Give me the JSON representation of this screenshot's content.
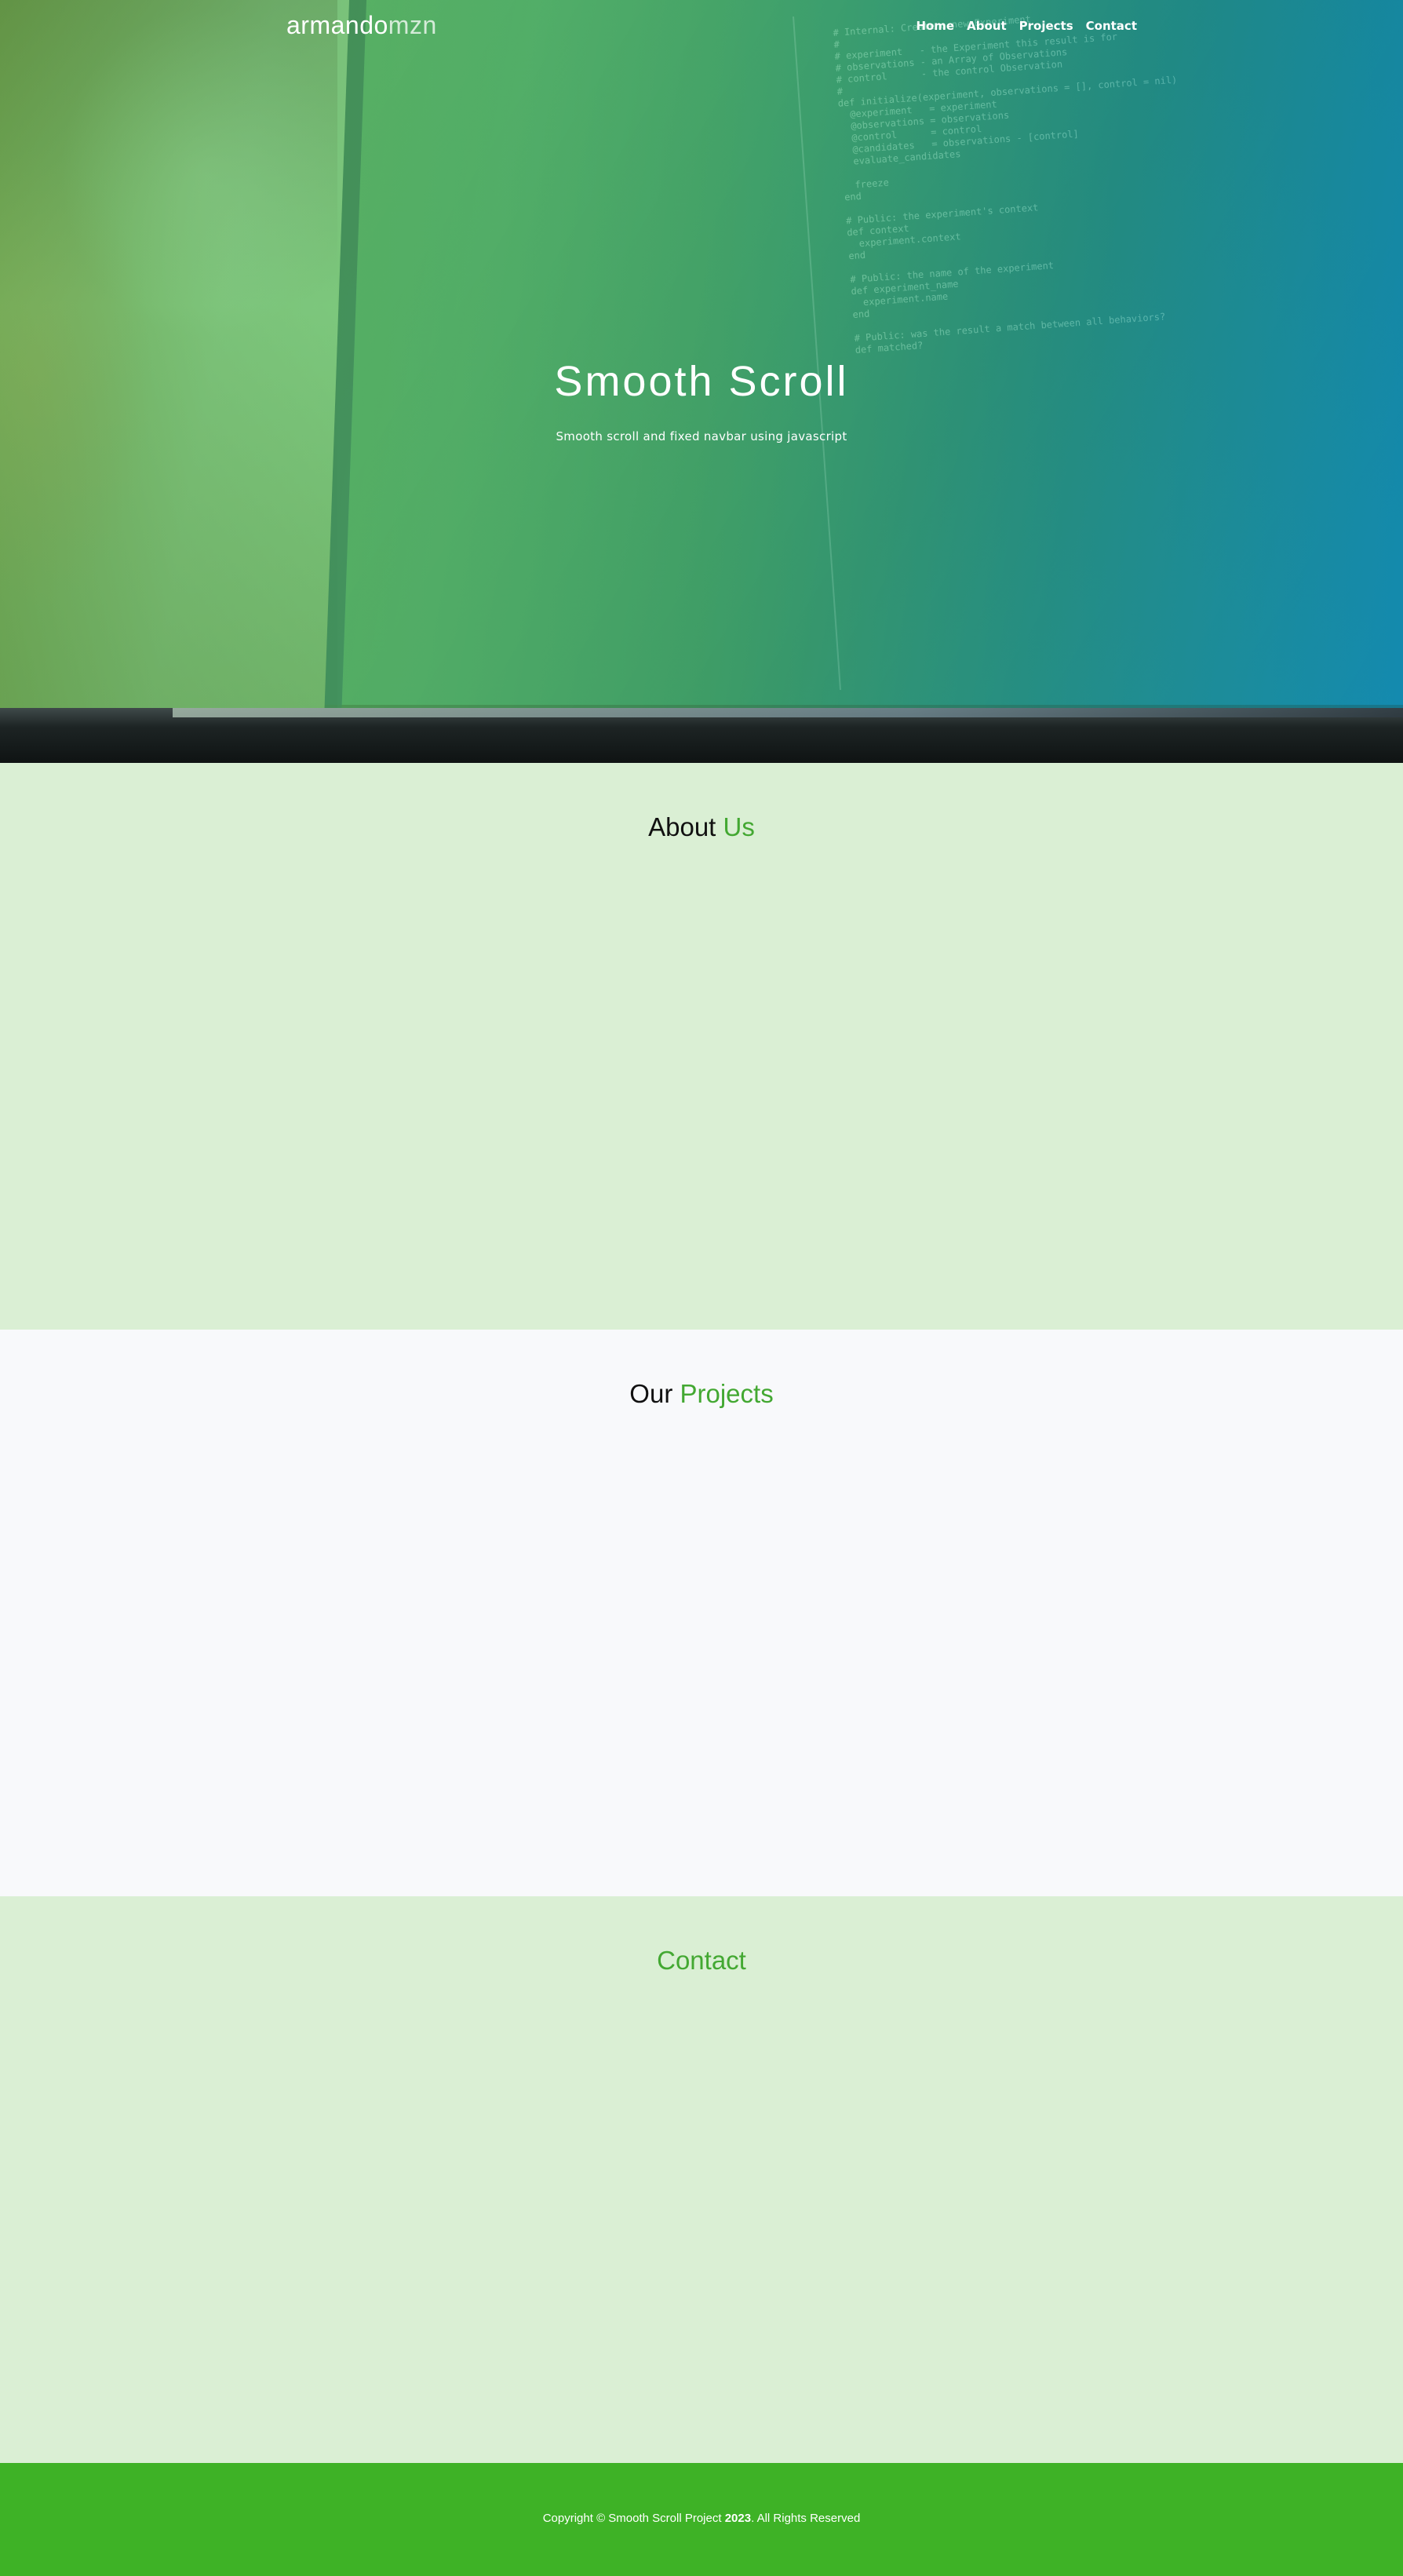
{
  "navbar": {
    "brand_bold": "armando",
    "brand_light": "mzn",
    "links": [
      "Home",
      "About",
      "Projects",
      "Contact"
    ]
  },
  "hero": {
    "title": "Smooth Scroll",
    "subtitle": "Smooth scroll and fixed navbar using javascript"
  },
  "about": {
    "title_plain": "About ",
    "title_accent": "Us"
  },
  "projects": {
    "title_plain": "Our ",
    "title_accent": "Projects"
  },
  "contact": {
    "title_accent": "Contact"
  },
  "footer": {
    "prefix": "Copyright © Smooth Scroll Project ",
    "year": "2023",
    "suffix": ". All Rights Reserved"
  },
  "colors": {
    "accent": "#43a832",
    "footer_bg": "#3eb226",
    "section_green": "#daefd4",
    "section_light": "#f8f9fb"
  }
}
